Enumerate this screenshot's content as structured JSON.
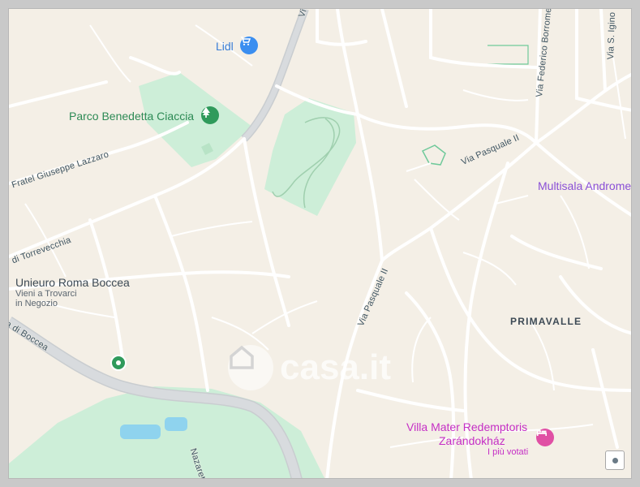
{
  "map": {
    "colors": {
      "land": "#f4efe6",
      "park": "#cdeed8",
      "water": "#8fd3ee",
      "road": "#ffffff",
      "major_road": "#cfd3d6"
    },
    "places": {
      "lidl": "Lidl",
      "park": "Parco Benedetta Ciaccia",
      "unieuro": "Unieuro Roma Boccea",
      "unieuro_sub1": "Vieni a Trovarci",
      "unieuro_sub2": "in Negozio",
      "multisala": "Multisala Androme",
      "district": "PRIMAVALLE",
      "villa": "Villa Mater Redemptoris",
      "villa_sub": "Zarándokház",
      "villa_note": "I più votati"
    },
    "streets": {
      "federico": "Via Federico Borrome",
      "igino": "Via S. Igino P",
      "pasquale_top": "Via Pasquale II",
      "pasquale": "Via Pasquale II",
      "lazzaro": "Fratel Giuseppe Lazzaro",
      "torrevecchia": "di Torrevecchia",
      "boccea": "a di Boccea",
      "nazareth": "Nazareth",
      "v_top": "Vi"
    },
    "watermark": "casa.it",
    "icons": [
      "shopping-cart-icon",
      "tree-icon",
      "map-pin-icon",
      "hotel-bed-icon",
      "layers-icon",
      "house-logo-icon"
    ]
  }
}
